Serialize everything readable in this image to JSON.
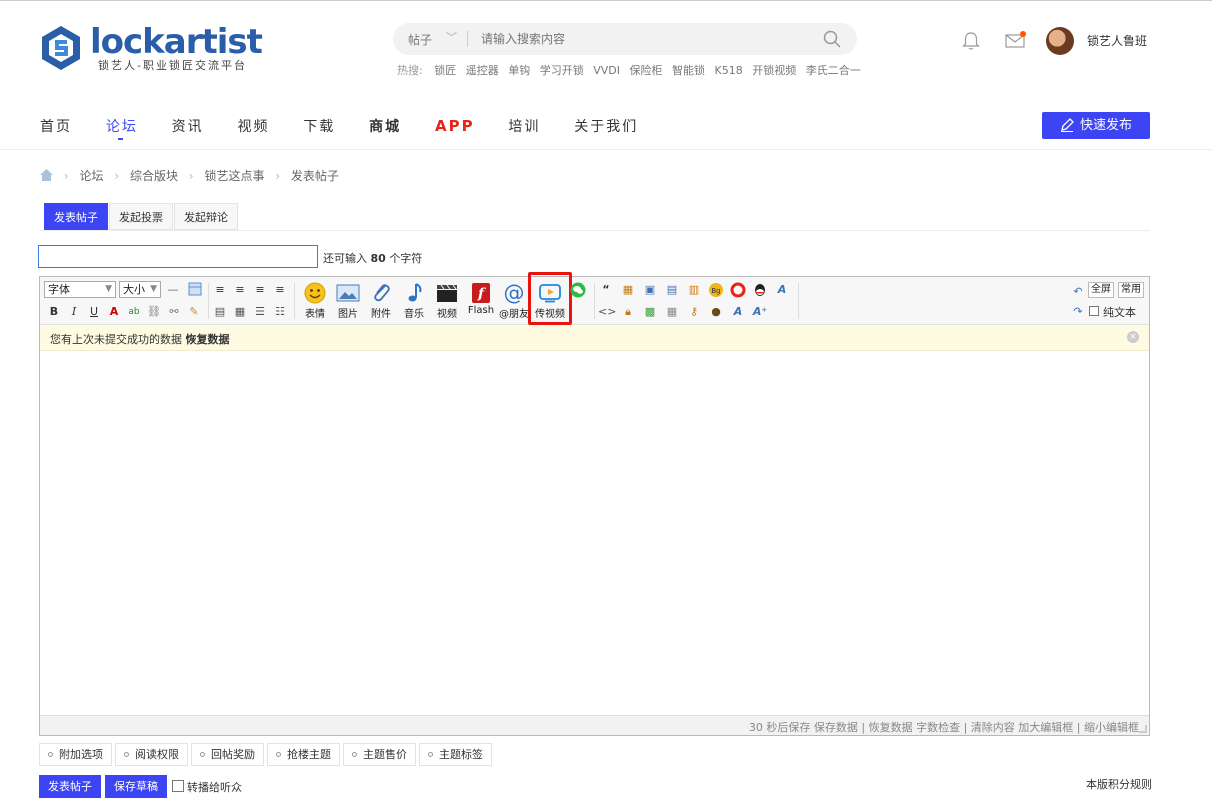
{
  "header": {
    "logo_text": "lockartist",
    "logo_subtitle": "锁艺人-职业锁匠交流平台",
    "search_type": "帖子",
    "search_placeholder": "请输入搜索内容",
    "hot_label": "热搜:",
    "hot_terms": [
      "锁匠",
      "遥控器",
      "单钩",
      "学习开锁",
      "VVDI",
      "保险柜",
      "智能锁",
      "K518",
      "开锁视频",
      "李氏二合一"
    ],
    "username": "锁艺人鲁班"
  },
  "nav": {
    "items": [
      "首页",
      "论坛",
      "资讯",
      "视频",
      "下载",
      "商城",
      "APP",
      "培训",
      "关于我们"
    ],
    "publish_label": "快速发布"
  },
  "breadcrumb": [
    "论坛",
    "综合版块",
    "锁艺这点事",
    "发表帖子"
  ],
  "tabs": [
    "发表帖子",
    "发起投票",
    "发起辩论"
  ],
  "title_field": {
    "value": "",
    "remaining_prefix": "还可输入",
    "remaining_count": "80",
    "remaining_suffix": "个字符"
  },
  "toolbar": {
    "font_select": "字体",
    "size_select": "大小",
    "big_buttons": [
      "表情",
      "图片",
      "附件",
      "音乐",
      "视频",
      "Flash",
      "@朋友",
      "传视频"
    ],
    "fullscreen": "全屏",
    "common": "常用",
    "plain_text": "纯文本"
  },
  "restore_bar": {
    "message": "您有上次未提交成功的数据",
    "action": "恢复数据"
  },
  "status_bar": "30 秒后保存 保存数据 | 恢复数据    字数检查 | 清除内容    加大编辑框 | 缩小编辑框",
  "options": [
    "附加选项",
    "阅读权限",
    "回帖奖励",
    "抢楼主题",
    "主题售价",
    "主题标签"
  ],
  "actions": {
    "post": "发表帖子",
    "draft": "保存草稿",
    "broadcast": "转播给听众",
    "rules": "本版积分规则"
  },
  "colors": {
    "accent": "#3c44f3",
    "highlight": "#e8150f",
    "app": "#e8231a"
  }
}
